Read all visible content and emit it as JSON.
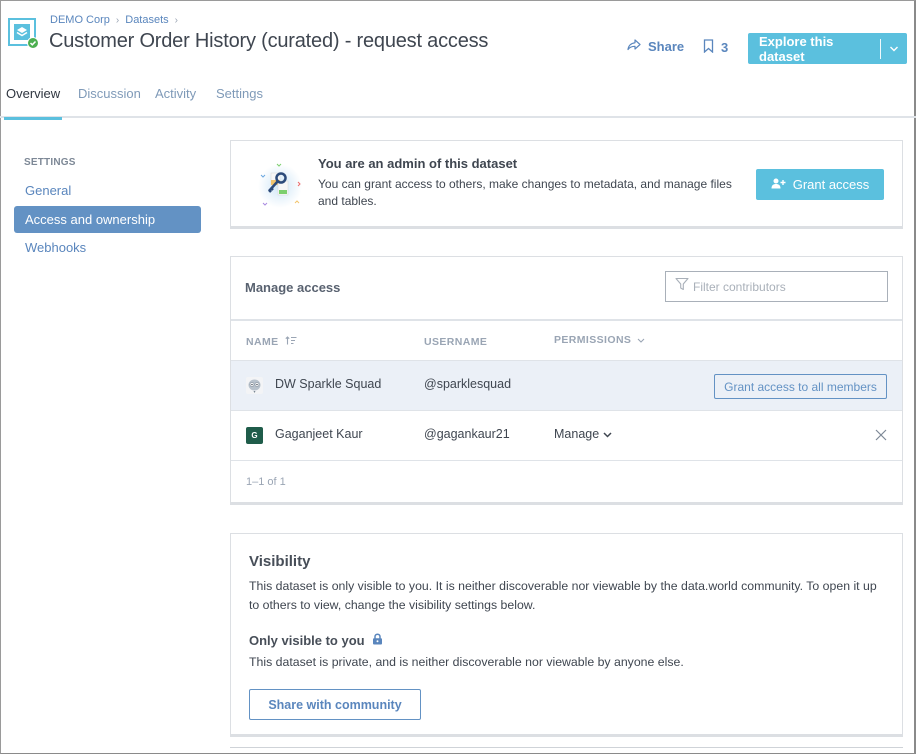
{
  "header": {
    "breadcrumb": [
      "DEMO Corp",
      "Datasets"
    ],
    "breadcrumb_separator": "›",
    "title": "Customer Order History (curated) - request access",
    "share_label": "Share",
    "bookmark_count": "3",
    "explore_label": "Explore this dataset",
    "icons": {
      "dataset": "dataset-layers-icon",
      "status": "check-circle-icon",
      "share": "share-arrow-icon",
      "bookmark": "bookmark-icon",
      "caret": "chevron-down-icon"
    }
  },
  "tabs": [
    {
      "label": "Overview",
      "active": true
    },
    {
      "label": "Discussion",
      "active": false
    },
    {
      "label": "Activity",
      "active": false
    },
    {
      "label": "Settings",
      "active": false
    }
  ],
  "sidebar": {
    "section_title": "SETTINGS",
    "items": [
      {
        "label": "General",
        "active": false
      },
      {
        "label": "Access and ownership",
        "active": true
      },
      {
        "label": "Webhooks",
        "active": false
      }
    ]
  },
  "admin_notice": {
    "title": "You are an admin of this dataset",
    "description": "You can grant access to others, make changes to metadata, and manage files and tables.",
    "grant_button": "Grant access"
  },
  "manage_access": {
    "title": "Manage access",
    "filter_placeholder": "Filter contributors",
    "filter_value": "",
    "columns": {
      "name": "NAME",
      "username": "USERNAME",
      "permissions": "PERMISSIONS"
    },
    "rows": [
      {
        "name": "DW Sparkle Squad",
        "username": "@sparklesquad",
        "permission": "",
        "action": "Grant access to all members",
        "avatar": "owl-avatar",
        "highlight": true
      },
      {
        "name": "Gaganjeet Kaur",
        "username": "@gagankaur21",
        "permission": "Manage",
        "avatar_letter": "G",
        "avatar_color": "#1f5c4a",
        "highlight": false
      }
    ],
    "pagination": "1–1 of 1"
  },
  "visibility": {
    "title": "Visibility",
    "description": "This dataset is only visible to you. It is neither discoverable nor viewable by the data.world community. To open it up to others to view, change the visibility settings below.",
    "status_title": "Only visible to you",
    "status_description": "This dataset is private, and is neither discoverable nor viewable by anyone else.",
    "share_button": "Share with community"
  },
  "colors": {
    "accent": "#5bc0de",
    "link": "#5a86bd",
    "sidebar_active": "#6392c4",
    "row_highlight": "#ebf0f7"
  }
}
